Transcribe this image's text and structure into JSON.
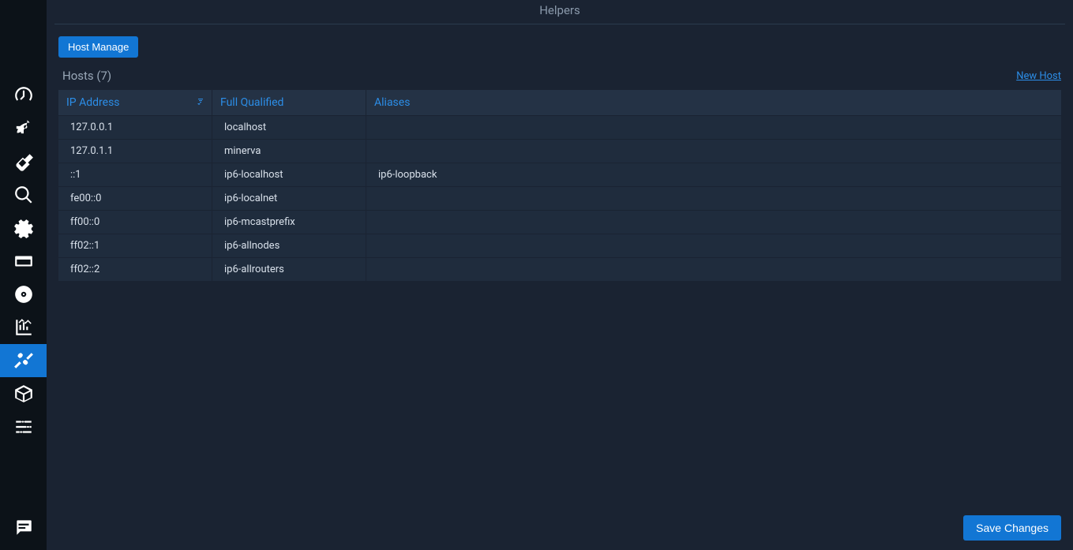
{
  "header": {
    "title": "Helpers"
  },
  "tabs": {
    "host_manage": "Host Manage"
  },
  "subheader": {
    "hosts_label": "Hosts (7)",
    "new_host": "New Host"
  },
  "table": {
    "columns": {
      "ip": "IP Address",
      "fq": "Full Qualified",
      "aliases": "Aliases"
    },
    "rows": [
      {
        "ip": "127.0.0.1",
        "fq": "localhost",
        "aliases": ""
      },
      {
        "ip": "127.0.1.1",
        "fq": "minerva",
        "aliases": ""
      },
      {
        "ip": "::1",
        "fq": "ip6-localhost",
        "aliases": "ip6-loopback"
      },
      {
        "ip": "fe00::0",
        "fq": "ip6-localnet",
        "aliases": ""
      },
      {
        "ip": "ff00::0",
        "fq": "ip6-mcastprefix",
        "aliases": ""
      },
      {
        "ip": "ff02::1",
        "fq": "ip6-allnodes",
        "aliases": ""
      },
      {
        "ip": "ff02::2",
        "fq": "ip6-allrouters",
        "aliases": ""
      }
    ]
  },
  "footer": {
    "save": "Save Changes"
  },
  "sidebar": {
    "items": [
      {
        "name": "dashboard-icon"
      },
      {
        "name": "rocket-icon"
      },
      {
        "name": "broom-icon"
      },
      {
        "name": "search-icon"
      },
      {
        "name": "gear-icon"
      },
      {
        "name": "card-icon"
      },
      {
        "name": "disk-icon"
      },
      {
        "name": "chart-icon"
      },
      {
        "name": "tools-icon",
        "active": true
      },
      {
        "name": "package-icon"
      },
      {
        "name": "sliders-icon"
      }
    ],
    "bottom": {
      "name": "comment-icon"
    }
  }
}
